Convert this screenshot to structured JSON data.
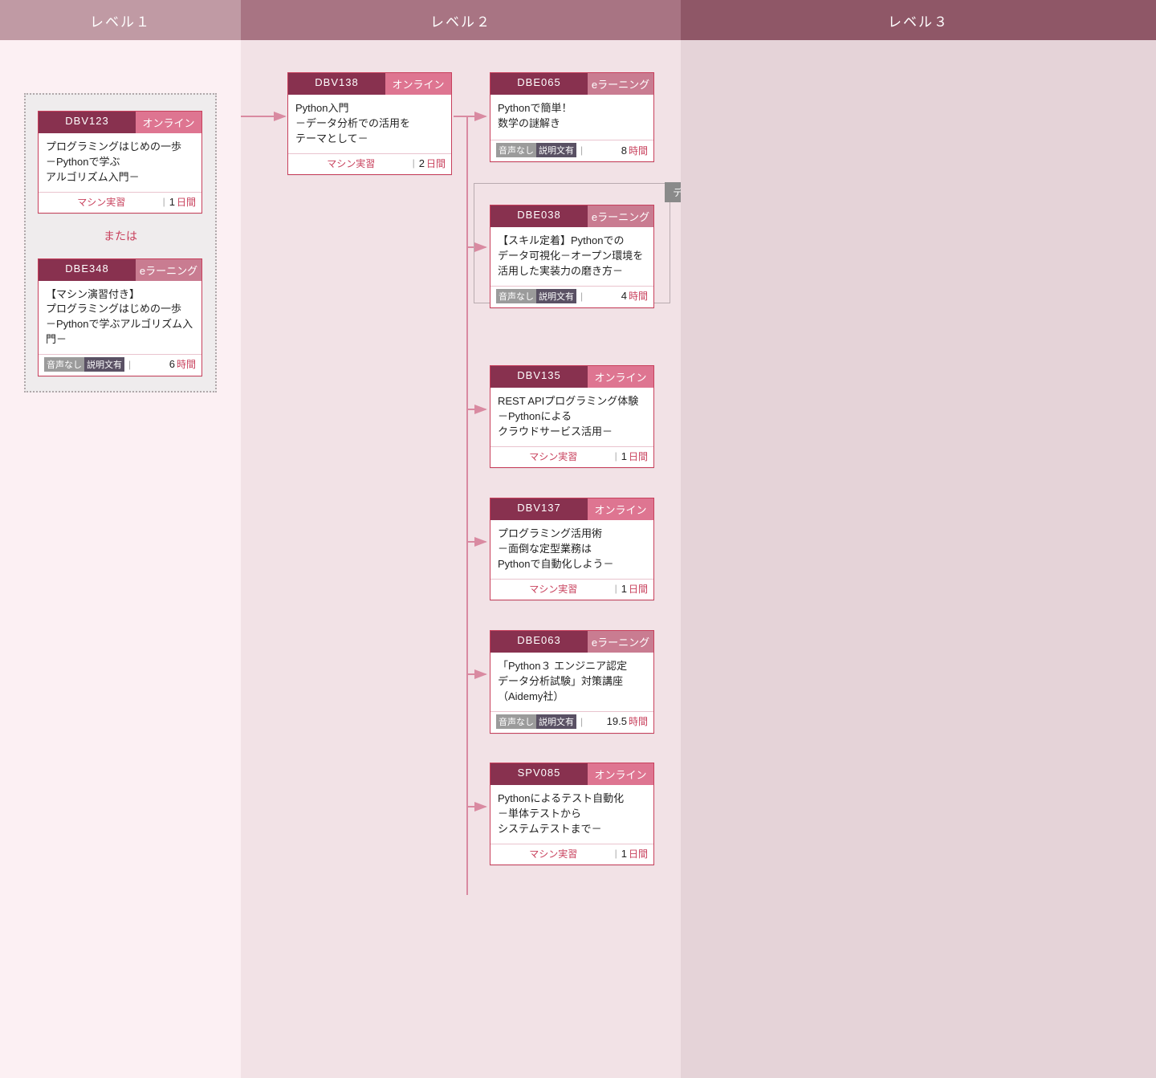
{
  "levels": {
    "l1": "レベル１",
    "l2": "レベル２",
    "l3": "レベル３"
  },
  "or_label": "または",
  "ref_tag": "データサイエンス",
  "badges": {
    "online": "オンライン",
    "elearn": "eラーニング",
    "machine": "マシン実習",
    "noaudio": "音声なし",
    "hastext": "説明文有"
  },
  "units": {
    "day": "日間",
    "hour": "時間"
  },
  "cards": {
    "dbv123": {
      "code": "DBV123",
      "title": "プログラミングはじめの一歩\n－Pythonで学ぶ\nアルゴリズム入門－",
      "duration": "1"
    },
    "dbe348": {
      "code": "DBE348",
      "title": "【マシン演習付き】\nプログラミングはじめの一歩\n－Pythonで学ぶアルゴリズム入門－",
      "duration": "6"
    },
    "dbv138": {
      "code": "DBV138",
      "title": "Python入門\n－データ分析での活用を\nテーマとして－",
      "duration": "2"
    },
    "dbe065": {
      "code": "DBE065",
      "title": "Pythonで簡単！\n数学の謎解き",
      "duration": "8"
    },
    "dbe038": {
      "code": "DBE038",
      "title": "【スキル定着】Pythonでの\nデータ可視化－オープン環境を\n活用した実装力の磨き方－",
      "duration": "4"
    },
    "dbv135": {
      "code": "DBV135",
      "title": "REST APIプログラミング体験\n－Pythonによる\nクラウドサービス活用－",
      "duration": "1"
    },
    "dbv137": {
      "code": "DBV137",
      "title": "プログラミング活用術\n－面倒な定型業務は\nPythonで自動化しよう－",
      "duration": "1"
    },
    "dbe063": {
      "code": "DBE063",
      "title": "「Python３ エンジニア認定\nデータ分析試験」対策講座\n（Aidemy社）",
      "duration": "19.5"
    },
    "spv085": {
      "code": "SPV085",
      "title": "Pythonによるテスト自動化\n－単体テストから\nシステムテストまで－",
      "duration": "1"
    }
  }
}
